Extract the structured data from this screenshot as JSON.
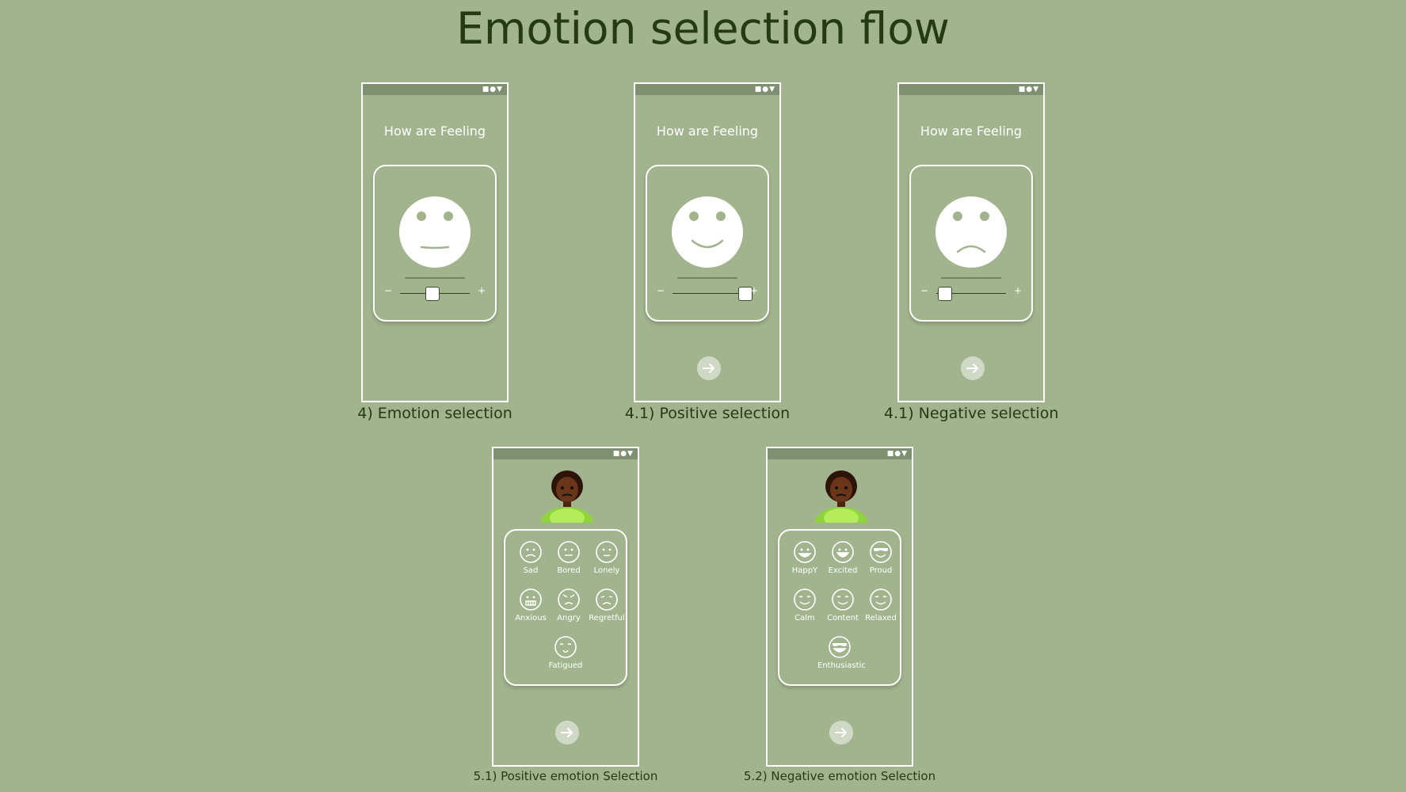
{
  "title": "Emotion selection flow",
  "screens": [
    {
      "heading": "How are Feeling",
      "caption": "4) Emotion selection",
      "slider_value": 0.5,
      "mood": "neutral",
      "has_next": false
    },
    {
      "heading": "How are Feeling",
      "caption": "4.1) Positive selection",
      "slider_value": 0.95,
      "mood": "happy",
      "has_next": true
    },
    {
      "heading": "How are Feeling",
      "caption": "4.1) Negative selection",
      "slider_value": 0.05,
      "mood": "sad",
      "has_next": true
    }
  ],
  "slider": {
    "minus": "−",
    "plus": "+"
  },
  "status_icons": "■●▼",
  "emotion_screens": [
    {
      "caption": "5.1) Positive emotion Selection",
      "emotions": [
        {
          "label": "Sad",
          "icon": "sad-face-icon"
        },
        {
          "label": "Bored",
          "icon": "bored-face-icon"
        },
        {
          "label": "Lonely",
          "icon": "lonely-face-icon"
        },
        {
          "label": "Anxious",
          "icon": "anxious-face-icon"
        },
        {
          "label": "Angry",
          "icon": "angry-face-icon"
        },
        {
          "label": "Regretful",
          "icon": "regretful-face-icon"
        },
        {
          "label": "Fatigued",
          "icon": "fatigued-face-icon"
        }
      ]
    },
    {
      "caption": "5.2) Negative emotion Selection",
      "emotions": [
        {
          "label": "HappY",
          "icon": "happy-face-icon"
        },
        {
          "label": "Excited",
          "icon": "excited-face-icon"
        },
        {
          "label": "Proud",
          "icon": "proud-face-icon"
        },
        {
          "label": "Calm",
          "icon": "calm-face-icon"
        },
        {
          "label": "Content",
          "icon": "content-face-icon"
        },
        {
          "label": "Relaxed",
          "icon": "relaxed-face-icon"
        },
        {
          "label": "Enthusiastic",
          "icon": "enthusiastic-face-icon"
        }
      ]
    }
  ],
  "colors": {
    "background": "#a2b48e",
    "title": "#233a12",
    "frame": "#ffffff",
    "status_bar": "#7f9070",
    "face_feature": "#a2b48e"
  }
}
